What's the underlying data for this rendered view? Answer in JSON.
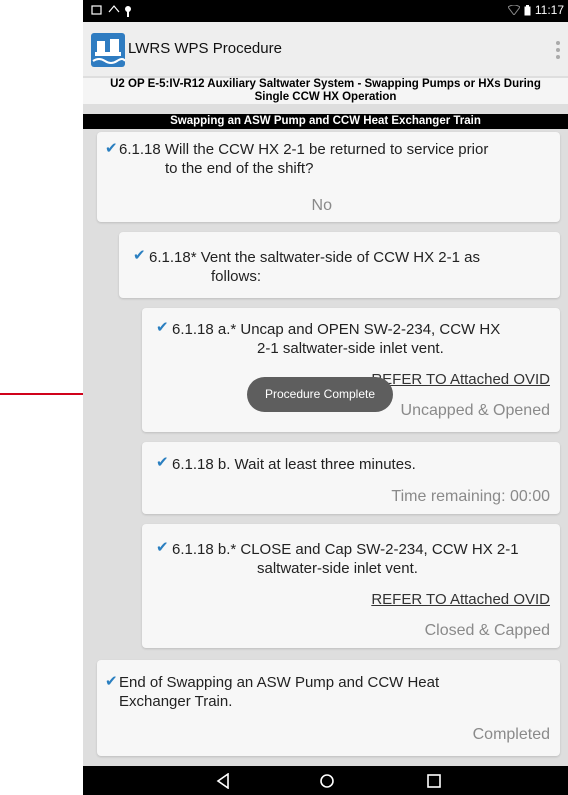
{
  "status_bar": {
    "time": "11:17"
  },
  "app": {
    "title": "LWRS WPS Procedure"
  },
  "procedure": {
    "title_line1": "U2 OP E-5:IV-R12 Auxiliary Saltwater System - Swapping Pumps or HXs During",
    "title_line2": "Single CCW HX Operation",
    "section": "Swapping an ASW Pump and CCW Heat Exchanger Train"
  },
  "steps": [
    {
      "line1": "6.1.18 Will the CCW HX 2-1 be returned to service prior",
      "line2": "to the end of the shift?",
      "status": "No"
    },
    {
      "line1": "6.1.18* Vent the saltwater-side of CCW HX 2-1 as",
      "line2": "follows:"
    },
    {
      "line1": "6.1.18 a.* Uncap and OPEN SW-2-234, CCW HX",
      "line2": "2-1 saltwater-side inlet vent.",
      "refer": "REFER TO Attached OVID",
      "status": "Uncapped & Opened"
    },
    {
      "line1": "6.1.18 b. Wait at least three minutes.",
      "status": "Time remaining: 00:00"
    },
    {
      "line1": "6.1.18 b.* CLOSE and Cap SW-2-234, CCW HX 2-1",
      "line2": "saltwater-side inlet vent.",
      "refer": "REFER TO Attached OVID",
      "status": "Closed & Capped"
    },
    {
      "line1": "End of Swapping an ASW Pump and CCW Heat",
      "line2": "Exchanger Train.",
      "status": "Completed"
    }
  ],
  "toast": {
    "message": "Procedure Complete"
  },
  "icons": {
    "check": "checkmark-icon",
    "back": "back-icon",
    "home": "home-icon",
    "recents": "recents-icon",
    "overflow": "overflow-menu-icon"
  },
  "colors": {
    "check": "#2a7fc0",
    "arrow": "#d0021b",
    "toast": "#5e5e5e"
  }
}
